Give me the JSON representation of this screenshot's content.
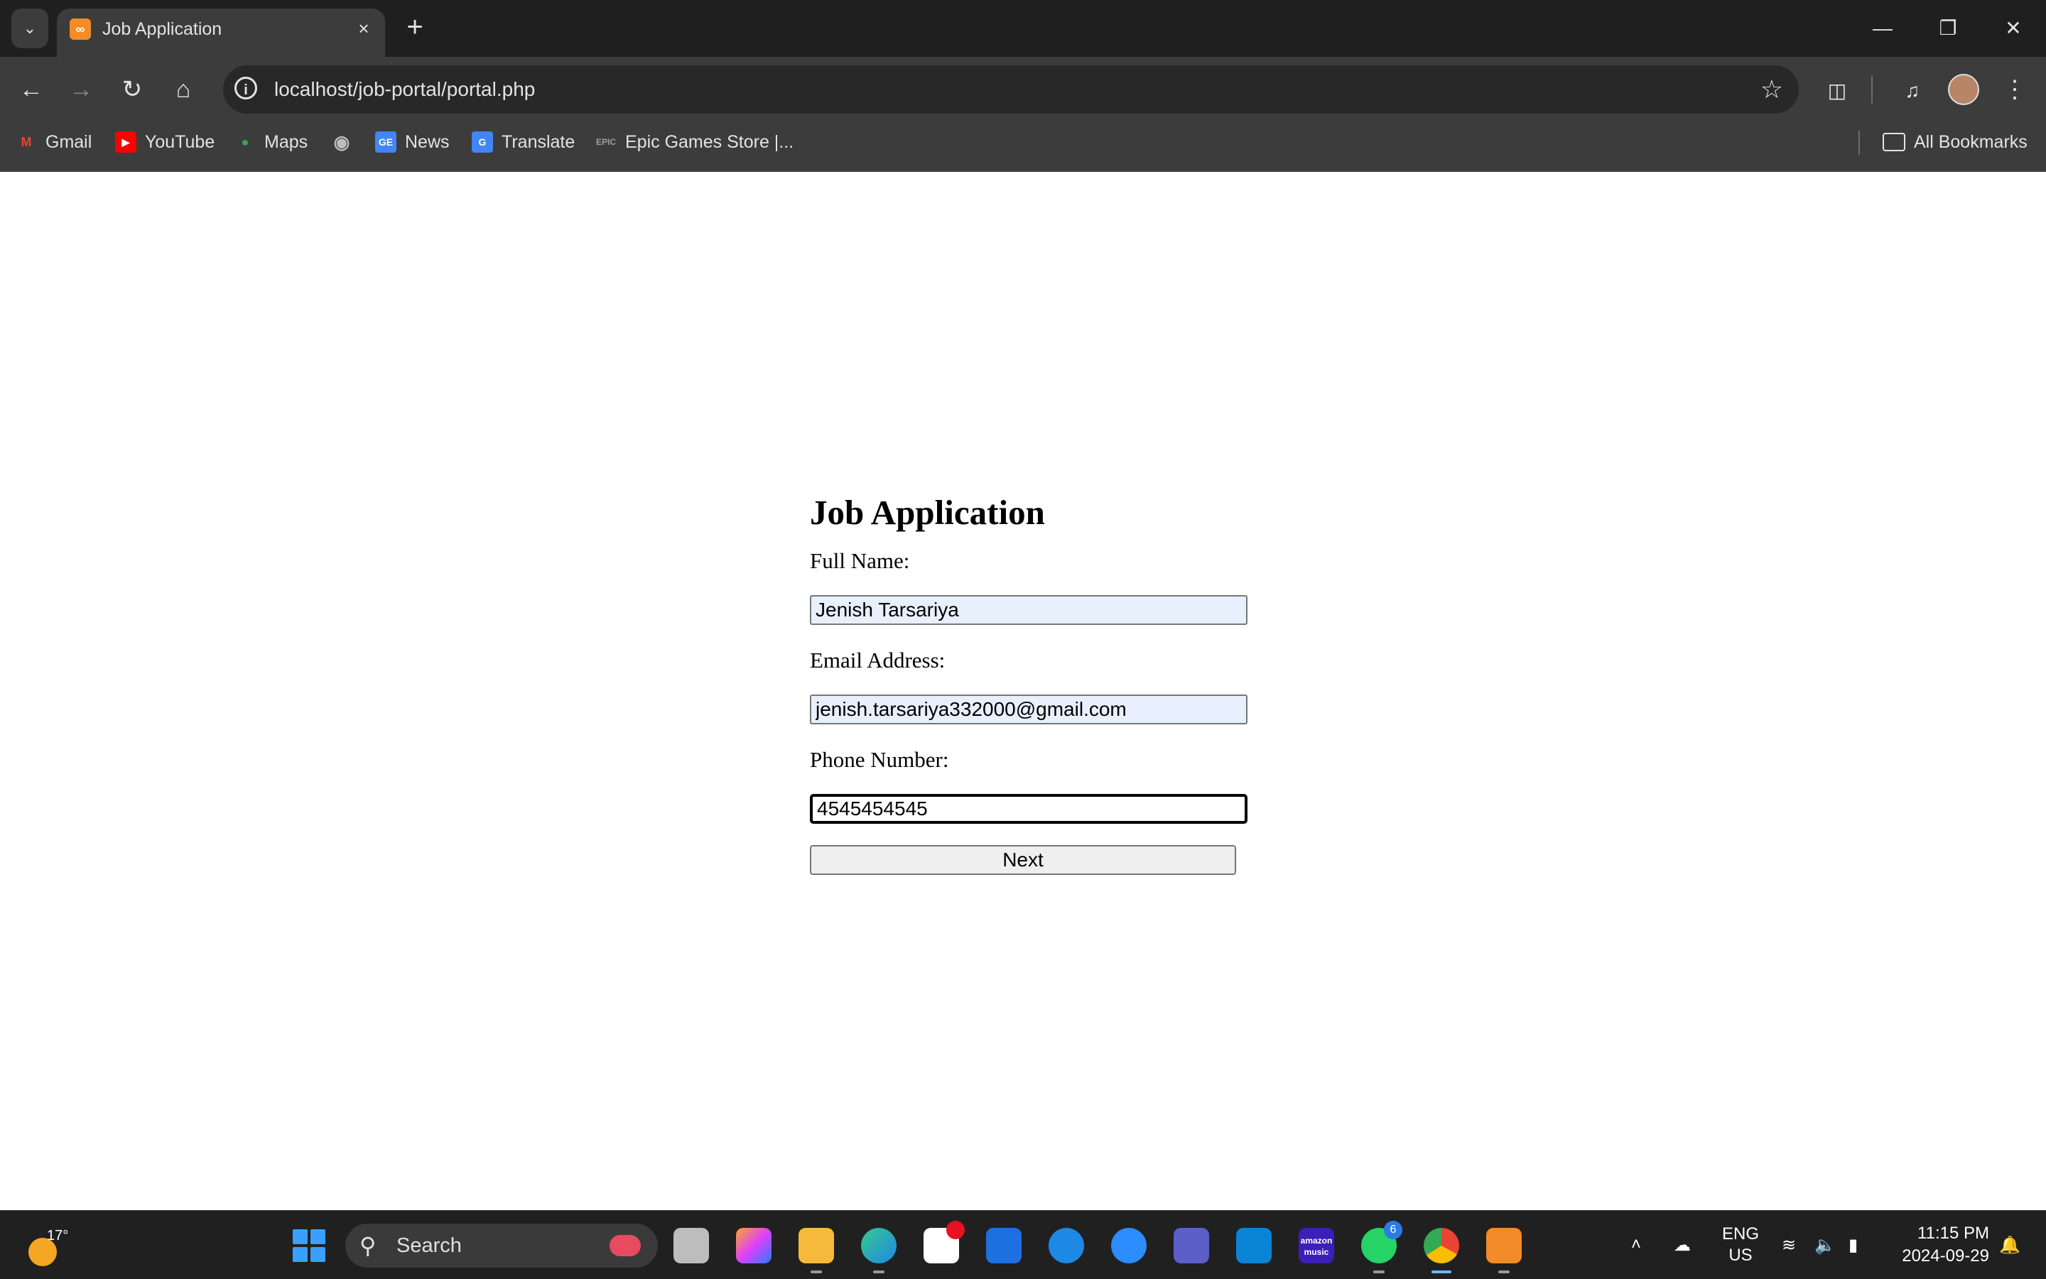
{
  "browser": {
    "tab": {
      "title": "Job Application",
      "favicon": "xampp-icon"
    },
    "url": "localhost/job-portal/portal.php",
    "bookmarks": [
      {
        "label": "Gmail",
        "icon": "gmail-icon",
        "color": "#ea4335"
      },
      {
        "label": "YouTube",
        "icon": "youtube-icon",
        "color": "#ff0000"
      },
      {
        "label": "Maps",
        "icon": "maps-icon",
        "color": "#34a853"
      },
      {
        "label": "",
        "icon": "globe-icon",
        "color": "#bdbdbd"
      },
      {
        "label": "News",
        "icon": "news-icon",
        "color": "#4285f4"
      },
      {
        "label": "Translate",
        "icon": "translate-icon",
        "color": "#4285f4"
      },
      {
        "label": "Epic Games Store |...",
        "icon": "epic-games-icon",
        "color": "#9e9e9e"
      }
    ],
    "all_bookmarks": "All Bookmarks"
  },
  "form": {
    "heading": "Job Application",
    "full_name_label": "Full Name:",
    "full_name_value": "Jenish Tarsariya",
    "email_label": "Email Address:",
    "email_value": "jenish.tarsariya332000@gmail.com",
    "phone_label": "Phone Number:",
    "phone_value": "4545454545",
    "next_label": "Next"
  },
  "taskbar": {
    "weather_temp": "17°",
    "search_label": "Search",
    "apps": [
      "task-view-icon",
      "copilot-icon",
      "file-explorer-icon",
      "edge-icon",
      "microsoft-store-icon",
      "app-icon",
      "sync-icon",
      "zoom-icon",
      "teams-icon",
      "windows-app-icon",
      "amazon-music-icon",
      "whatsapp-icon",
      "chrome-icon",
      "xampp-icon"
    ],
    "whatsapp_badge": "6",
    "amazon_label": "amazon music",
    "lang_top": "ENG",
    "lang_bottom": "US",
    "time": "11:15 PM",
    "date": "2024-09-29"
  }
}
